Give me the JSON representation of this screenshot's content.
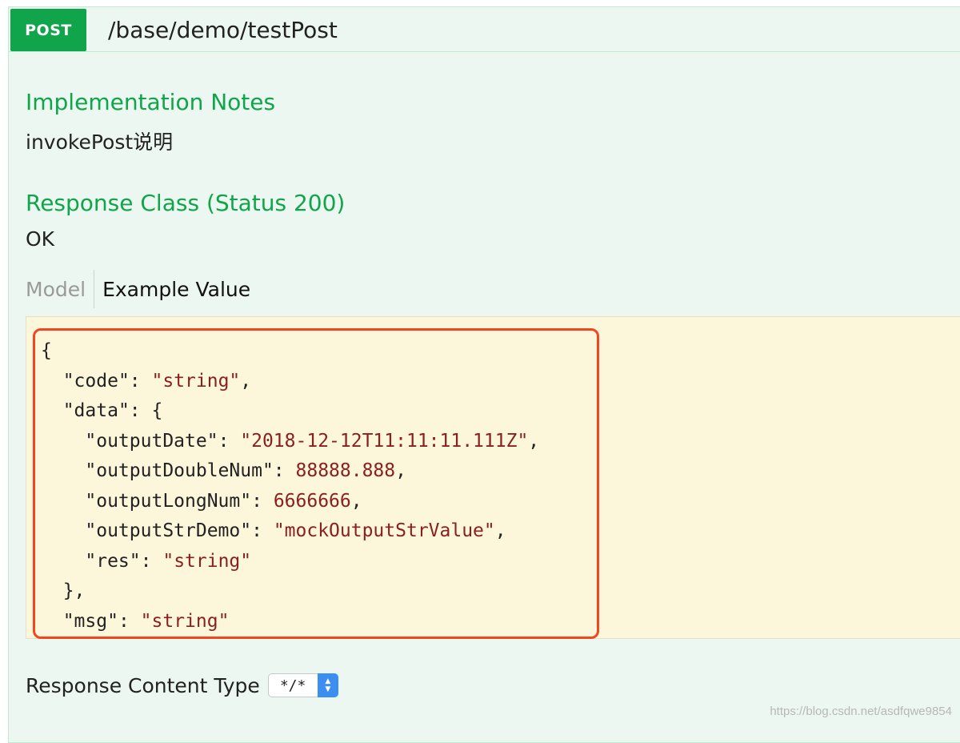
{
  "operation": {
    "method": "POST",
    "path": "/base/demo/testPost"
  },
  "implementation_notes": {
    "title": "Implementation Notes",
    "text": "invokePost说明"
  },
  "response_class": {
    "title": "Response Class (Status 200)",
    "text": "OK"
  },
  "tabs": [
    {
      "label": "Model",
      "active": false
    },
    {
      "label": "Example Value",
      "active": true
    }
  ],
  "example_value": {
    "open_brace": "{",
    "code_key": "\"code\"",
    "code_val": "\"string\"",
    "data_key": "\"data\"",
    "data_open": "{",
    "outputDate_key": "\"outputDate\"",
    "outputDate_val": "\"2018-12-12T11:11:11.111Z\"",
    "outputDoubleNum_key": "\"outputDoubleNum\"",
    "outputDoubleNum_val": "88888.888",
    "outputLongNum_key": "\"outputLongNum\"",
    "outputLongNum_val": "6666666",
    "outputStrDemo_key": "\"outputStrDemo\"",
    "outputStrDemo_val": "\"mockOutputStrValue\"",
    "res_key": "\"res\"",
    "res_val": "\"string\"",
    "data_close": "},",
    "msg_key": "\"msg\"",
    "msg_val": "\"string\""
  },
  "response_content_type": {
    "label": "Response Content Type",
    "selected": "*/*"
  },
  "watermark": "https://blog.csdn.net/asdfqwe9854",
  "colors": {
    "method_post": "#10a54a",
    "panel_bg": "#ebf7f0",
    "code_bg": "#fcf6db",
    "highlight_border": "#f2461e",
    "string_value": "#8a1f1f"
  }
}
